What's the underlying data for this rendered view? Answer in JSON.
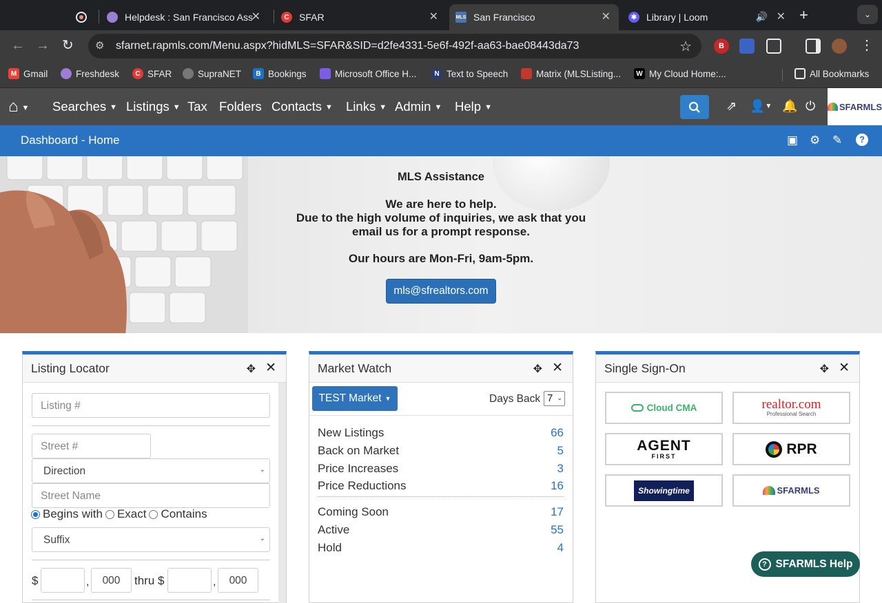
{
  "browser": {
    "tabs": [
      {
        "title": "",
        "favicon": "record-icon"
      },
      {
        "title": "Helpdesk : San Francisco Ass",
        "favicon": "freshdesk-icon"
      },
      {
        "title": "SFAR",
        "favicon": "sfar-icon"
      },
      {
        "title": "San Francisco",
        "favicon": "mls-icon"
      },
      {
        "title": "Library | Loom",
        "favicon": "loom-icon"
      }
    ],
    "url": "sfarnet.rapmls.com/Menu.aspx?hidMLS=SFAR&SID=d2fe4331-5e6f-492f-aa63-bae08443da73",
    "bookmarks": [
      "Gmail",
      "Freshdesk",
      "SFAR",
      "SupraNET",
      "Bookings",
      "Microsoft Office H...",
      "Text to Speech",
      "Matrix (MLSListing...",
      "My Cloud Home:...",
      "All Bookmarks"
    ]
  },
  "nav": {
    "items": [
      "Searches",
      "Listings",
      "Tax",
      "Folders",
      "Contacts",
      "Links",
      "Admin",
      "Help"
    ],
    "logo": "SFARMLS"
  },
  "breadcrumb": "Dashboard - Home",
  "hero": {
    "title": "MLS Assistance",
    "line1": "We are here to help.",
    "line2": "Due to the high volume of inquiries, we ask that you",
    "line3": "email us for a prompt response.",
    "line4": "Our hours are Mon-Fri, 9am-5pm.",
    "email": "mls@sfrealtors.com"
  },
  "listing_locator": {
    "title": "Listing Locator",
    "listing_placeholder": "Listing #",
    "street_placeholder": "Street #",
    "direction": "Direction",
    "street_name_placeholder": "Street Name",
    "radio_options": [
      "Begins with",
      "Exact",
      "Contains"
    ],
    "suffix": "Suffix",
    "dollar": "$",
    "comma": ",",
    "thousands": "000",
    "thru": "thru $"
  },
  "market_watch": {
    "title": "Market Watch",
    "market_button": "TEST Market",
    "days_back_label": "Days Back",
    "days_back_value": "7",
    "rows_a": [
      {
        "label": "New Listings",
        "value": "66"
      },
      {
        "label": "Back on Market",
        "value": "5"
      },
      {
        "label": "Price Increases",
        "value": "3"
      },
      {
        "label": "Price Reductions",
        "value": "16"
      }
    ],
    "rows_b": [
      {
        "label": "Coming Soon",
        "value": "17"
      },
      {
        "label": "Active",
        "value": "55"
      },
      {
        "label": "Hold",
        "value": "4"
      }
    ]
  },
  "single_sign_on": {
    "title": "Single Sign-On",
    "tiles": [
      "Cloud CMA",
      "realtor.com",
      "Professional Search",
      "AGENT",
      "FIRST",
      "RPR",
      "Showingtime",
      "SFARMLS"
    ]
  },
  "help_button": "SFARMLS Help",
  "colors": {
    "nav": "#4a4a4a",
    "accent": "#2a73c2",
    "help": "#1c5e58"
  }
}
